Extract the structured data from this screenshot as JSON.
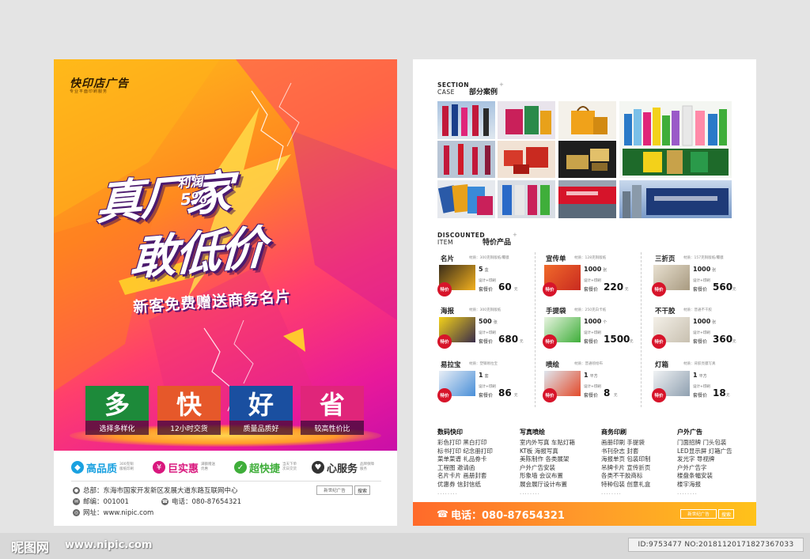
{
  "left": {
    "brand": "快印店广告",
    "brand_sub": "专业平面印刷服务",
    "headline1": "真厂家",
    "headline2": "敢低价",
    "profit_label": "利润",
    "profit_value": "5%",
    "subline": "新客免费赠送商务名片",
    "tiles": [
      {
        "big": "多",
        "cap": "选择多样化",
        "color": "#1d8a3a"
      },
      {
        "big": "快",
        "cap": "12小时交货",
        "color": "#e6582a"
      },
      {
        "big": "好",
        "cap": "质量品质好",
        "color": "#1a4fa0"
      },
      {
        "big": "省",
        "cap": "较高性价比",
        "color": "#e0257a"
      }
    ],
    "features": [
      {
        "label": "高品质",
        "sub": "300克铜版纸印刷",
        "color": "#1aa1e0",
        "icon": "diamond-icon",
        "glyph": "◆"
      },
      {
        "label": "巨实惠",
        "sub": "满额赠送优惠",
        "color": "#d9177d",
        "icon": "yen-icon",
        "glyph": "¥"
      },
      {
        "label": "超快捷",
        "sub": "当天下单次日交货",
        "color": "#3fae3a",
        "icon": "leaf-icon",
        "glyph": "✓"
      },
      {
        "label": "心服务",
        "sub": "品牌保障服务",
        "color": "#333333",
        "icon": "heart-icon",
        "glyph": "♥"
      }
    ],
    "address": "总部：东海市国家开发新区发展大道东路互联网中心",
    "postcode": "邮编：001001",
    "tel": "电话：080-87654321",
    "website": "网址：www.nipic.com",
    "search_box": "新世纪广告",
    "search_btn": "搜索"
  },
  "right": {
    "case_en1": "SECTION",
    "case_en2": "CASE",
    "case_cn": "部分案例",
    "disc_en1": "DISCOUNTED",
    "disc_en2": "ITEM",
    "disc_cn": "特价产品",
    "products": [
      {
        "name": "名片",
        "mat": "材质：300克铜版纸/覆膜",
        "qty": "5",
        "unit": "盒",
        "price": "60",
        "color": "#f3b11e"
      },
      {
        "name": "宣传单",
        "mat": "材质：128克铜版纸",
        "qty": "1000",
        "unit": "张",
        "price": "220",
        "color": "#e34a2a"
      },
      {
        "name": "三折页",
        "mat": "材质：157克铜版纸/覆膜",
        "qty": "1000",
        "unit": "张",
        "price": "560",
        "color": "#c8b89a"
      },
      {
        "name": "海报",
        "mat": "材质：300克铜版纸",
        "qty": "500",
        "unit": "张",
        "price": "680",
        "color": "#3a2d4a"
      },
      {
        "name": "手提袋",
        "mat": "材质：250克白卡纸",
        "qty": "1000",
        "unit": "个",
        "price": "1500",
        "color": "#3fae3a"
      },
      {
        "name": "不干胶",
        "mat": "材质：普通不干胶",
        "qty": "1000",
        "unit": "张",
        "price": "360",
        "color": "#d9d4c8"
      },
      {
        "name": "易拉宝",
        "mat": "材质：塑钢易拉宝",
        "qty": "1",
        "unit": "套",
        "price": "86",
        "color": "#4a8fd8"
      },
      {
        "name": "喷绘",
        "mat": "材质：普通喷绘布",
        "qty": "1",
        "unit": "平方",
        "price": "8",
        "color": "#e34a2a"
      },
      {
        "name": "灯箱",
        "mat": "材质：背胶亮膜写真",
        "qty": "1",
        "unit": "平方",
        "price": "18",
        "color": "#8fa0b0"
      }
    ],
    "design_note": "设计+印刷",
    "set_label": "套餐价",
    "yuan": "元",
    "tejia": "特价",
    "services": [
      {
        "title": "数码快印",
        "items": [
          "彩色打印 黑白打印",
          "标书打印 纪念册打印",
          "菜单菜谱 礼品券卡",
          "工程图 邀请函",
          "名片卡片 画册封套",
          "优惠券 信封信纸"
        ]
      },
      {
        "title": "写真喷绘",
        "items": [
          "室内外写真 车贴灯箱",
          "KT板 海报写真",
          "美陈制作 各类展架",
          "户外广告安装",
          "形象墙 会议布置",
          "展会展厅设计布置"
        ]
      },
      {
        "title": "商务印刷",
        "items": [
          "画册印刷 手提袋",
          "书刊杂志 封套",
          "海报单页 包装印制",
          "吊牌卡片 宣传折页",
          "各类不干胶商标",
          "特种包装 创意礼盒"
        ]
      },
      {
        "title": "户外广告",
        "items": [
          "门面招牌 门头包装",
          "LED显示屏 灯箱广告",
          "发光字 导视牌",
          "户外广告字",
          "楼盘条幅安装",
          "楼宇海报"
        ]
      }
    ],
    "dots": "........",
    "phone": "电话：080-87654321",
    "search_box": "新世纪广告",
    "search_btn": "搜索"
  },
  "watermark": {
    "logo": "昵图网",
    "url": "www.nipic.com",
    "id": "ID:9753477 NO:20181120171827367033"
  }
}
